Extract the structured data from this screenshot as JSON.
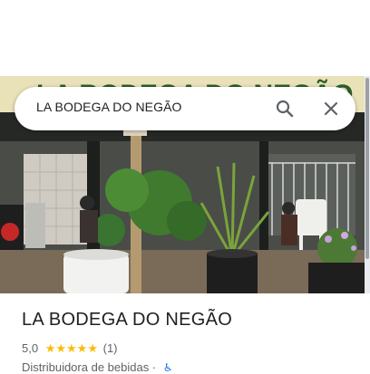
{
  "search": {
    "query": "LA BODEGA DO NEGÃO"
  },
  "place": {
    "name": "LA BODEGA DO NEGÃO",
    "rating": "5,0",
    "stars": "★★★★★",
    "review_count": "(1)",
    "category": "Distribuidora de bebidas ·",
    "accessibility_icon": "wheelchair-icon",
    "rating_value": 5.0,
    "rating_max": 5
  },
  "photo": {
    "sign_text": "LA BODEGA DO NEGÃO",
    "sign_color": "#e9e2b8"
  },
  "icons": {
    "search": "search-icon",
    "close": "close-icon"
  },
  "colors": {
    "star": "#fbbc04",
    "text_primary": "#202124",
    "text_secondary": "#5f6368",
    "accent": "#1a73e8"
  }
}
